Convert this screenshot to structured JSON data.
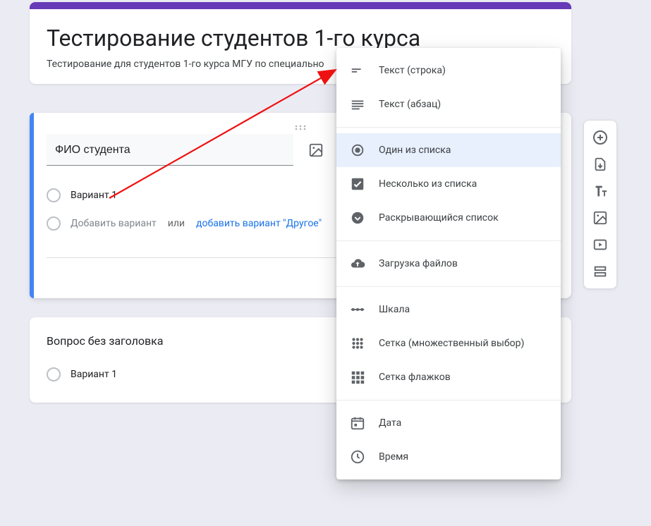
{
  "header": {
    "title": "Тестирование студентов 1-го курса",
    "description": "Тестирование для студентов 1-го курса МГУ по специально"
  },
  "question1": {
    "title": "ФИО студента",
    "option1": "Вариант 1",
    "add_option": "Добавить вариант",
    "or_text": "или",
    "add_other": "добавить вариант \"Другое\""
  },
  "question2": {
    "title": "Вопрос без заголовка",
    "option1": "Вариант 1"
  },
  "menu": {
    "short_answer": "Текст (строка)",
    "paragraph": "Текст (абзац)",
    "multiple_choice": "Один из списка",
    "checkboxes": "Несколько из списка",
    "dropdown": "Раскрывающийся список",
    "file_upload": "Загрузка файлов",
    "linear_scale": "Шкала",
    "grid_radio": "Сетка (множественный выбор)",
    "grid_check": "Сетка флажков",
    "date": "Дата",
    "time": "Время"
  }
}
